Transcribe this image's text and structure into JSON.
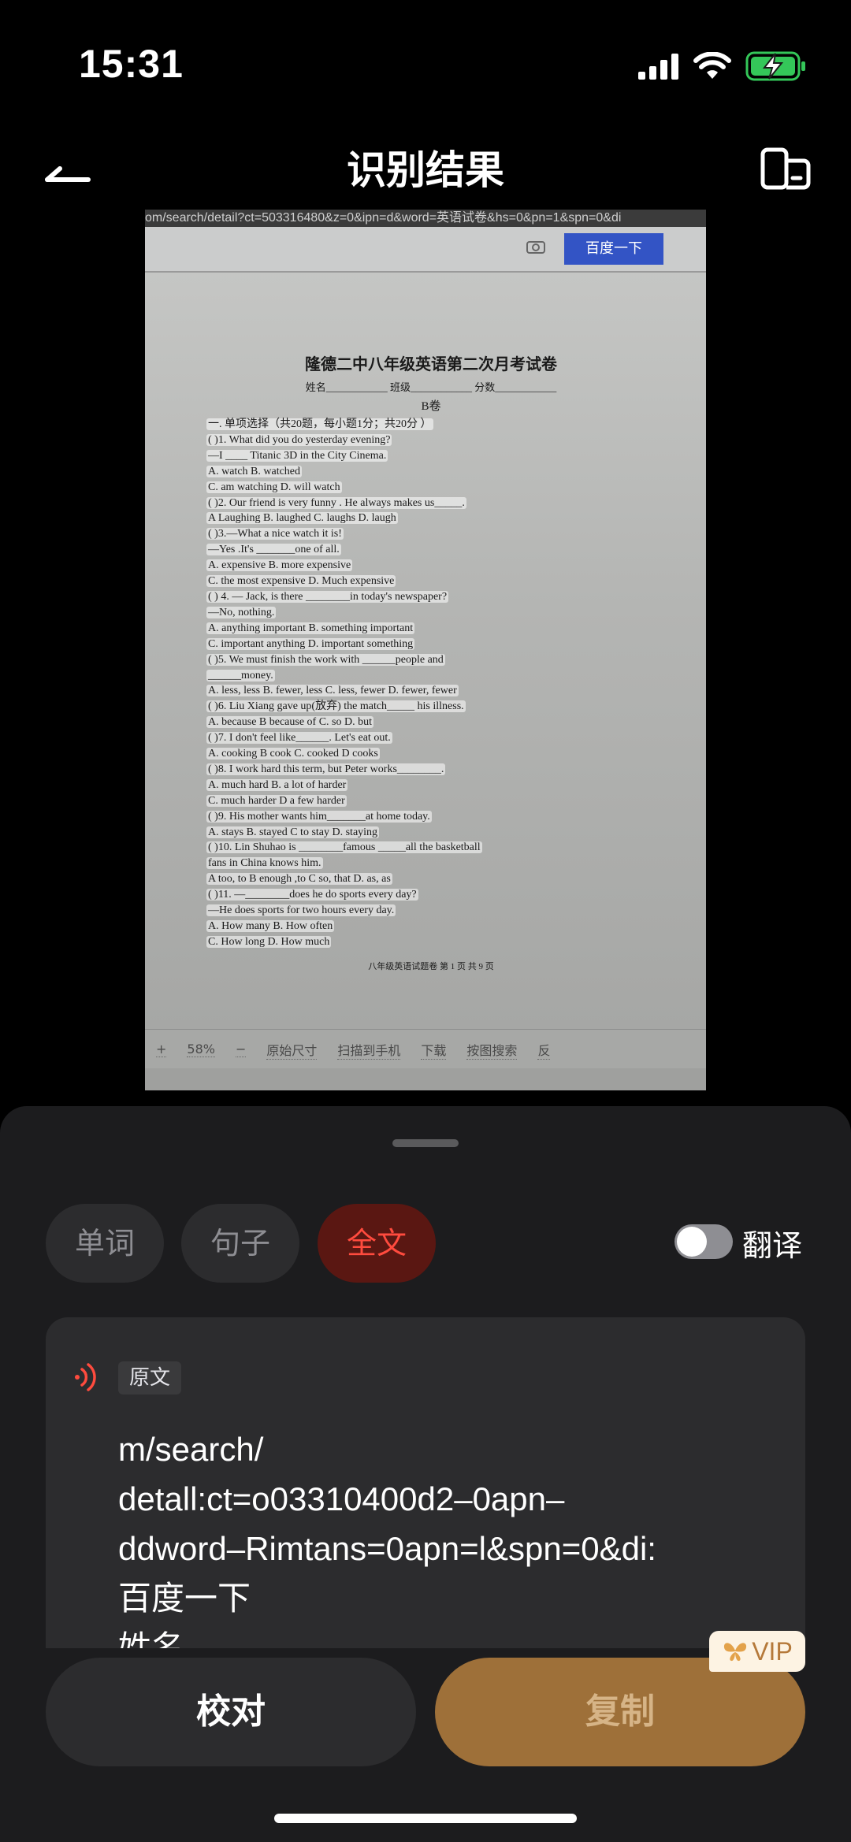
{
  "status_bar": {
    "time": "15:31"
  },
  "header": {
    "title": "识别结果",
    "back_icon": "arrow-left-icon",
    "switch_icon": "compare-pages-icon"
  },
  "document_preview": {
    "url_text": "om/search/detail?ct=503316480&z=0&ipn=d&word=英语试卷&hs=0&pn=1&spn=0&di",
    "search_button": "百度一下",
    "title": "隆德二中八年级英语第二次月考试卷",
    "fields": "姓名____________ 班级____________ 分数____________",
    "volume": "B卷",
    "lines": [
      "一. 单项选择（共20题，每小题1分；共20分 ）",
      "(      )1. What did you do yesterday evening?",
      "          —I ____ Titanic 3D in the City Cinema.",
      "          A. watch                B. watched",
      "          C. am watching          D. will watch",
      "(      )2. Our friend is very   funny . He   always makes us_____.",
      "          A   Laughing    B. laughed   C. laughs       D. laugh",
      "(      )3.—What a nice watch it is!",
      "          —Yes .It's _______one of all.",
      "          A. expensive             B. more expensive",
      "          C. the most expensive    D. Much expensive",
      "(      ) 4. — Jack, is there ________in today's   newspaper?",
      "          —No, nothing.",
      "          A. anything   important   B. something important",
      "          C. important   anything   D. important something",
      "(        )5.  We  must  finish  the  work  with  ______people  and",
      "______money.",
      "          A. less, less  B. fewer, less   C. less, fewer   D. fewer, fewer",
      "(      )6. Liu Xiang gave up(放弃) the match_____ his illness.",
      "          A. because   B because of      C. so         D. but",
      "(      )7. I don't feel like______. Let's eat out.",
      "          A. cooking     B cook          C. cooked        D cooks",
      "(      )8. I work hard this term, but Peter works________.",
      "          A. much hard              B. a lot of harder",
      "          C. much harder            D a few harder",
      "(      )9. His mother wants him_______at home today.",
      "          A. stays     B. stayed       C to stay        D. staying",
      "(      )10. Lin Shuhao is ________famous _____all the basketball",
      "fans in China knows him.",
      "          A too, to     B enough ,to     C   so, that       D. as, as",
      "(      )11. —________does he do sports every day?",
      "          —He does sports for two hours every day.",
      "          A. How many              B. How often",
      "          C. How long              D. How much"
    ],
    "footer": "八年级英语试题卷   第 1 页 共 9 页",
    "toolbar": [
      "+",
      "58%",
      "−",
      "原始尺寸",
      "扫描到手机",
      "下载",
      "按图搜索",
      "反"
    ]
  },
  "tabs": [
    {
      "label": "单词",
      "active": false
    },
    {
      "label": "句子",
      "active": false
    },
    {
      "label": "全文",
      "active": true
    }
  ],
  "translate": {
    "label": "翻译",
    "enabled": false
  },
  "result": {
    "source_tag": "原文",
    "lines": [
      "m/search/",
      "detall:ct=o03310400d2–0apn–",
      "ddword–Rimtans=0apn=l&spn=0&di:",
      "百度一下",
      "姓名"
    ]
  },
  "actions": {
    "proofread_label": "校对",
    "copy_label": "复制",
    "vip_label": "VIP"
  },
  "colors": {
    "accent_red": "#ff4b3e",
    "copy_button": "#9e7039",
    "sheet_bg": "#1c1c1e",
    "battery_green": "#34c759"
  }
}
